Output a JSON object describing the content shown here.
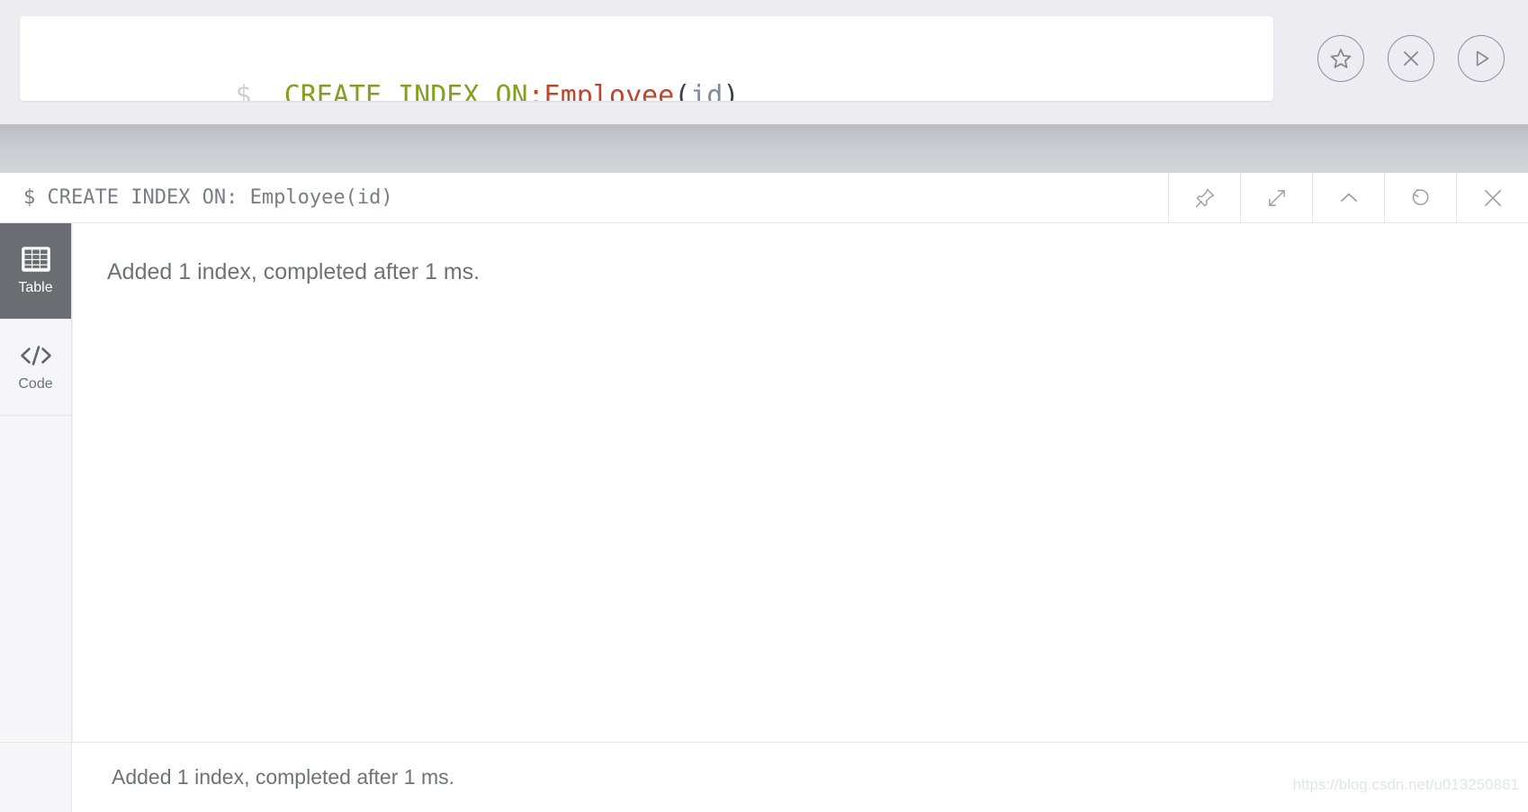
{
  "editor": {
    "prompt": "$",
    "query_tokens": [
      {
        "text": "CREATE INDEX ON",
        "kind": "keyword"
      },
      {
        "text": ":Employee",
        "kind": "label"
      },
      {
        "text": "(",
        "kind": "paren"
      },
      {
        "text": "id",
        "kind": "prop"
      },
      {
        "text": ")",
        "kind": "paren"
      }
    ],
    "query_plain": "CREATE INDEX ON:Employee(id)",
    "actions": [
      {
        "name": "favorite-button",
        "icon": "star-icon",
        "label": "Favorite"
      },
      {
        "name": "clear-button",
        "icon": "close-circle-icon",
        "label": "Clear"
      },
      {
        "name": "run-button",
        "icon": "play-icon",
        "label": "Run"
      }
    ],
    "colors": {
      "prompt": "#cfcfd4",
      "keyword": "#83a022",
      "label": "#c0452b",
      "paren": "#3a4149",
      "prop": "#7f8c99"
    }
  },
  "frame": {
    "title": "$ CREATE INDEX ON: Employee(id)",
    "tools": [
      {
        "name": "pin-button",
        "icon": "pin-icon",
        "label": "Pin"
      },
      {
        "name": "fullscreen-button",
        "icon": "expand-icon",
        "label": "Fullscreen"
      },
      {
        "name": "collapse-button",
        "icon": "chevron-up-icon",
        "label": "Collapse"
      },
      {
        "name": "rerun-button",
        "icon": "refresh-icon",
        "label": "Rerun"
      },
      {
        "name": "close-button",
        "icon": "close-icon",
        "label": "Close"
      }
    ],
    "sidebar": [
      {
        "name": "sidebar-item-table",
        "icon": "table-icon",
        "label": "Table",
        "active": true
      },
      {
        "name": "sidebar-item-code",
        "icon": "code-icon",
        "label": "Code",
        "active": false
      }
    ],
    "result_message": "Added 1 index, completed after 1 ms.",
    "status_message": "Added 1 index, completed after 1 ms."
  },
  "watermark": "https://blog.csdn.net/u013250861"
}
